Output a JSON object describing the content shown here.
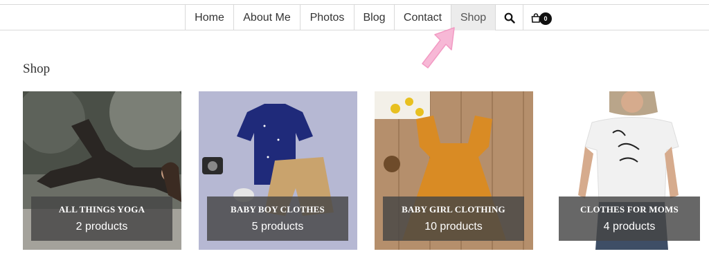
{
  "nav": {
    "items": [
      {
        "label": "Home"
      },
      {
        "label": "About Me"
      },
      {
        "label": "Photos"
      },
      {
        "label": "Blog"
      },
      {
        "label": "Contact"
      },
      {
        "label": "Shop",
        "active": true
      }
    ],
    "search_icon": "search-icon",
    "cart_icon": "shopping-bag-icon",
    "cart_count": "0"
  },
  "page": {
    "title": "Shop"
  },
  "categories": [
    {
      "name": "ALL THINGS YOGA",
      "count": "2 products"
    },
    {
      "name": "BABY BOY CLOTHES",
      "count": "5 products"
    },
    {
      "name": "BABY GIRL CLOTHING",
      "count": "10 products"
    },
    {
      "name": "CLOTHES FOR MOMS",
      "count": "4 products"
    }
  ],
  "colors": {
    "annotation_arrow": "#f7b8d6",
    "active_tab_bg": "#ececec",
    "overlay_bg": "#464646"
  }
}
